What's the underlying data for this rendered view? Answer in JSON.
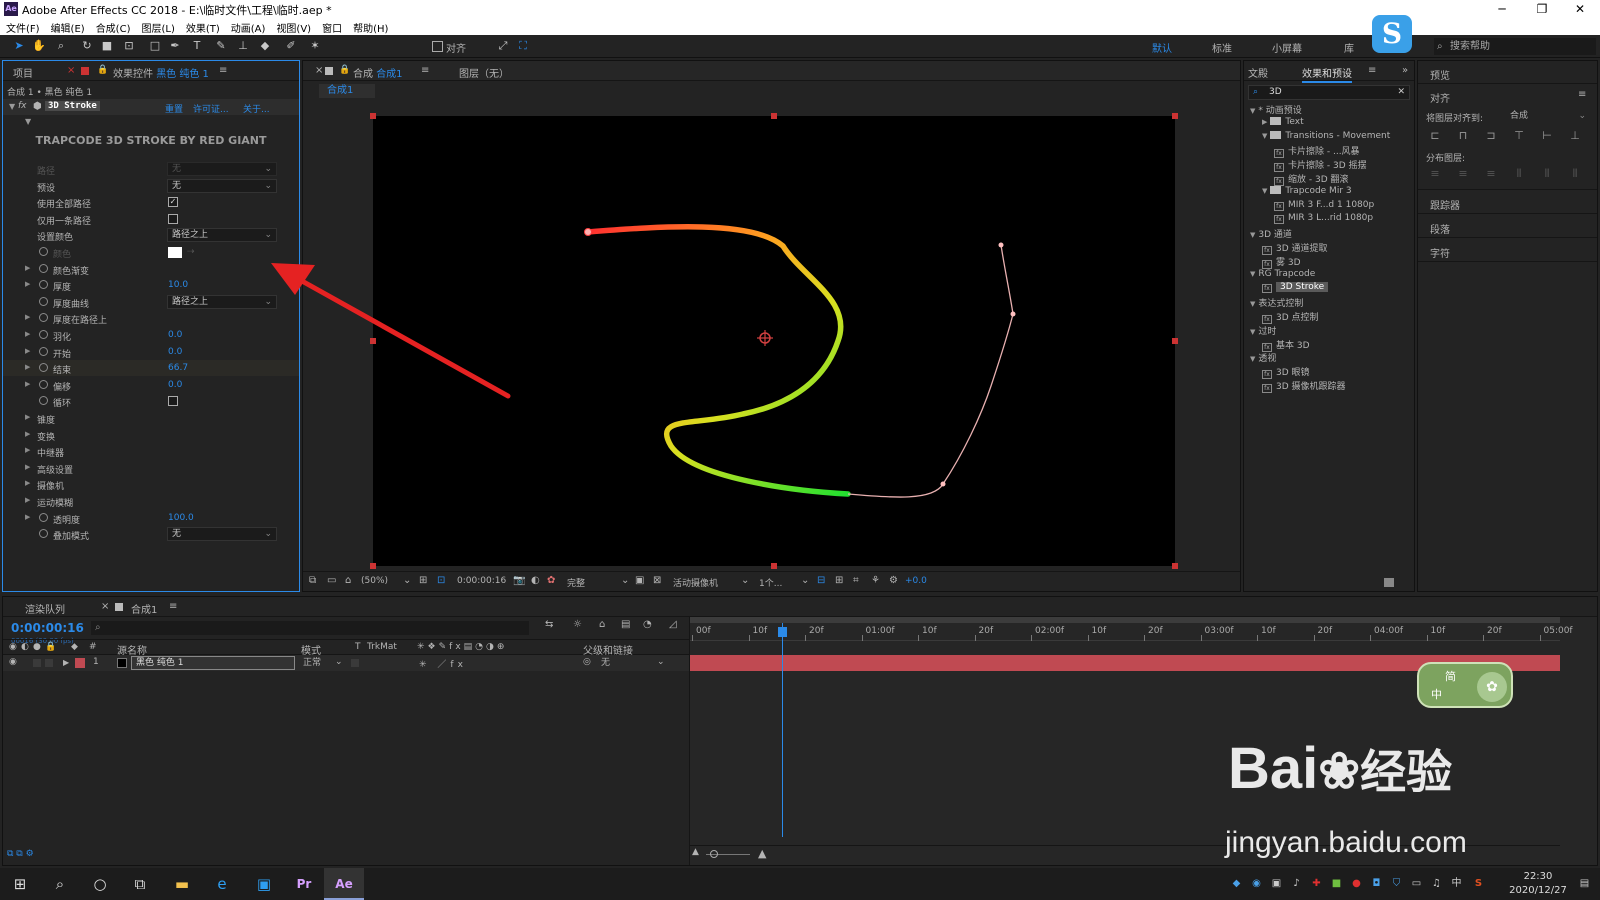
{
  "window": {
    "title": "Adobe After Effects CC 2018 - E:\\临时文件\\工程\\临时.aep *",
    "app_badge": "Ae"
  },
  "menu": [
    "文件(F)",
    "编辑(E)",
    "合成(C)",
    "图层(L)",
    "效果(T)",
    "动画(A)",
    "视图(V)",
    "窗口",
    "帮助(H)"
  ],
  "toolbar": {
    "align_label": "对齐",
    "workspaces": [
      "默认",
      "标准",
      "小屏幕",
      "库"
    ],
    "search_help": "搜索帮助"
  },
  "left_panel": {
    "tab_project": "项目",
    "tab_effects_prefix": "效果控件",
    "tab_effects_layer": "黑色 纯色 1",
    "breadcrumb": "合成 1 • 黑色 纯色 1",
    "effect_name": "3D Stroke",
    "effect_links": [
      "重置",
      "许可证...",
      "关于..."
    ],
    "header_text": "TRAPCODE 3D STROKE BY RED GIANT",
    "params": [
      {
        "label": "路径",
        "value": "无",
        "kind": "dd-dim"
      },
      {
        "label": "预设",
        "value": "无",
        "kind": "dd"
      },
      {
        "label": "使用全部路径",
        "value": "✓",
        "kind": "cb"
      },
      {
        "label": "仅用一条路径",
        "value": "",
        "kind": "cb"
      },
      {
        "label": "设置颜色",
        "value": "路径之上",
        "kind": "dd"
      },
      {
        "label": "颜色",
        "value": "",
        "kind": "color"
      },
      {
        "label": "颜色渐变",
        "value": "",
        "kind": "group"
      },
      {
        "label": "厚度",
        "value": "10.0",
        "kind": "num"
      },
      {
        "label": "厚度曲线",
        "value": "路径之上",
        "kind": "dd"
      },
      {
        "label": "厚度在路径上",
        "value": "",
        "kind": "group"
      },
      {
        "label": "羽化",
        "value": "0.0",
        "kind": "num"
      },
      {
        "label": "开始",
        "value": "0.0",
        "kind": "num"
      },
      {
        "label": "结束",
        "value": "66.7",
        "kind": "num"
      },
      {
        "label": "偏移",
        "value": "0.0",
        "kind": "num"
      },
      {
        "label": "循环",
        "value": "",
        "kind": "cb"
      },
      {
        "label": "锥度",
        "value": "",
        "kind": "section"
      },
      {
        "label": "变换",
        "value": "",
        "kind": "section"
      },
      {
        "label": "中继器",
        "value": "",
        "kind": "section"
      },
      {
        "label": "高级设置",
        "value": "",
        "kind": "section"
      },
      {
        "label": "摄像机",
        "value": "",
        "kind": "section"
      },
      {
        "label": "运动模糊",
        "value": "",
        "kind": "section"
      },
      {
        "label": "透明度",
        "value": "100.0",
        "kind": "num"
      },
      {
        "label": "叠加模式",
        "value": "无",
        "kind": "dd"
      }
    ]
  },
  "comp_panel": {
    "tab_comp_prefix": "合成",
    "tab_comp_name": "合成1",
    "tab_layer": "图层（无）",
    "subtab": "合成1",
    "zoom": "(50%)",
    "timecode": "0:00:00:16",
    "resolution": "完整",
    "camera": "活动摄像机",
    "views": "1个...",
    "exposure": "+0.0"
  },
  "effects_panel": {
    "tab_text": "文殿",
    "tab_effects": "效果和预设",
    "search": "3D",
    "tree": [
      {
        "label": "* 动画预设",
        "level": 0,
        "type": "cat"
      },
      {
        "label": "Text",
        "level": 1,
        "type": "folder"
      },
      {
        "label": "Transitions - Movement",
        "level": 1,
        "type": "folder"
      },
      {
        "label": "卡片擦除 - ...风暴",
        "level": 2,
        "type": "fx"
      },
      {
        "label": "卡片擦除 - 3D 摇摆",
        "level": 2,
        "type": "fx"
      },
      {
        "label": "缩放 - 3D 翻滚",
        "level": 2,
        "type": "fx"
      },
      {
        "label": "Trapcode Mir 3",
        "level": 1,
        "type": "folder"
      },
      {
        "label": "MIR 3 F...d 1 1080p",
        "level": 2,
        "type": "fx"
      },
      {
        "label": "MIR 3 L...rid 1080p",
        "level": 2,
        "type": "fx"
      },
      {
        "label": "3D 通道",
        "level": 0,
        "type": "cat"
      },
      {
        "label": "3D 通道提取",
        "level": 1,
        "type": "fx"
      },
      {
        "label": "雾 3D",
        "level": 1,
        "type": "fx"
      },
      {
        "label": "RG Trapcode",
        "level": 0,
        "type": "cat"
      },
      {
        "label": "3D Stroke",
        "level": 1,
        "type": "fx-sel"
      },
      {
        "label": "表达式控制",
        "level": 0,
        "type": "cat"
      },
      {
        "label": "3D 点控制",
        "level": 1,
        "type": "fx"
      },
      {
        "label": "过时",
        "level": 0,
        "type": "cat"
      },
      {
        "label": "基本 3D",
        "level": 1,
        "type": "fx"
      },
      {
        "label": "透视",
        "level": 0,
        "type": "cat"
      },
      {
        "label": "3D 眼镜",
        "level": 1,
        "type": "fx"
      },
      {
        "label": "3D 摄像机跟踪器",
        "level": 1,
        "type": "fx"
      }
    ]
  },
  "right_panel": {
    "preview": "预览",
    "align": "对齐",
    "align_to_label": "将图层对齐到:",
    "align_to_value": "合成",
    "distribute": "分布图层:",
    "tracker": "跟踪器",
    "paragraph": "段落",
    "character": "字符"
  },
  "timeline": {
    "tab_render": "渲染队列",
    "tab_comp": "合成1",
    "timecode": "0:00:00:16",
    "timecode_sub": "00016 (30.00 fps)",
    "col_source": "源名称",
    "col_mode": "模式",
    "col_t": "T",
    "col_trkmat": "TrkMat",
    "col_parent": "父级和链接",
    "layer_index": "1",
    "layer_name": "黑色 纯色 1",
    "layer_mode": "正常",
    "layer_parent": "无",
    "ruler": [
      "00f",
      "10f",
      "20f",
      "01:00f",
      "10f",
      "20f",
      "02:00f",
      "10f",
      "20f",
      "03:00f",
      "10f",
      "20f",
      "04:00f",
      "10f",
      "20f",
      "05:00f"
    ]
  },
  "ime": {
    "top": "简",
    "left": "中"
  },
  "watermark": {
    "brand": "Bai",
    "brand2": "经验",
    "url": "jingyan.baidu.com"
  },
  "taskbar": {
    "time": "22:30",
    "date": "2020/12/27",
    "ime": "中"
  },
  "icons": [
    "windows-icon",
    "search-icon",
    "cortana-icon",
    "task-view-icon",
    "explorer-icon",
    "edge-icon",
    "premiere-icon",
    "aftereffects-icon"
  ],
  "colors": {
    "accent": "#2b8ae8",
    "layer_bar": "#c04a52",
    "arrow": "#e52222"
  }
}
